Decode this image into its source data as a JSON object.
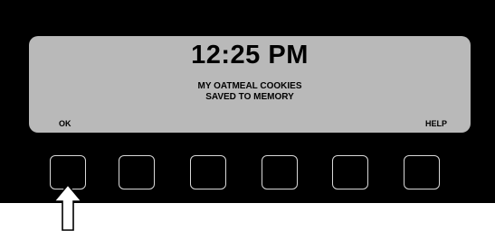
{
  "display": {
    "time": "12:25 PM",
    "message_line1": "MY OATMEAL COOKIES",
    "message_line2": "SAVED TO MEMORY",
    "soft_label_left": "OK",
    "soft_label_right": "HELP"
  },
  "keys": [
    "softkey-1",
    "softkey-2",
    "softkey-3",
    "softkey-4",
    "softkey-5",
    "softkey-6"
  ],
  "indicator": {
    "icon": "up-arrow-icon",
    "points_to": "softkey-1"
  },
  "colors": {
    "panel": "#000000",
    "lcd": "#b9b9b9",
    "key_border": "#d8d8d8",
    "text": "#000000"
  }
}
